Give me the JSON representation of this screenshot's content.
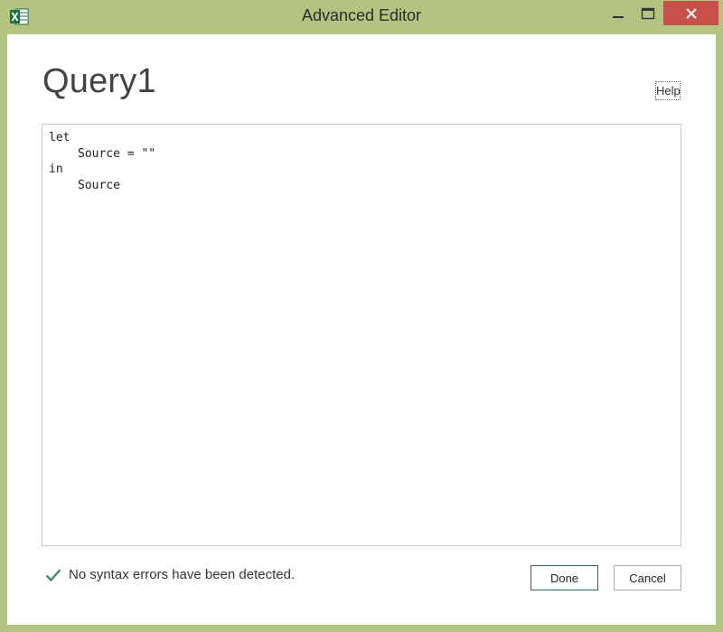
{
  "window": {
    "title": "Advanced Editor",
    "app_icon": "excel-icon",
    "close_color": "#c7504b",
    "frame_color": "#b3c380"
  },
  "dialog": {
    "query_name": "Query1",
    "help_label": "Help"
  },
  "editor": {
    "lines": [
      "let",
      "Source = \"\"",
      "in",
      "Source"
    ]
  },
  "status": {
    "icon": "checkmark-icon",
    "message": "No syntax errors have been detected.",
    "color": "#3e8e6a"
  },
  "buttons": {
    "done": "Done",
    "cancel": "Cancel"
  }
}
